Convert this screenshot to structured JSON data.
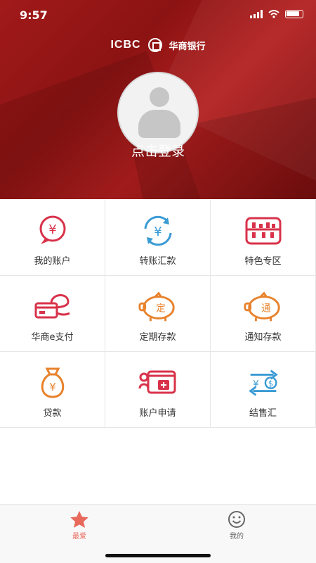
{
  "status": {
    "time": "9:57"
  },
  "brand": {
    "name_en": "ICBC",
    "name_cn": "华商银行"
  },
  "login": {
    "label": "点击登录"
  },
  "grid": [
    {
      "label": "我的账户",
      "icon": "yen-bubble-icon",
      "color": "#d8324a"
    },
    {
      "label": "转账汇款",
      "icon": "transfer-yen-icon",
      "color": "#3a9bd5"
    },
    {
      "label": "特色专区",
      "icon": "abacus-icon",
      "color": "#d8324a"
    },
    {
      "label": "华商e支付",
      "icon": "epay-card-icon",
      "color": "#d8324a"
    },
    {
      "label": "定期存款",
      "icon": "piggy-fixed-icon",
      "color": "#e8822c"
    },
    {
      "label": "通知存款",
      "icon": "piggy-notice-icon",
      "color": "#e8822c"
    },
    {
      "label": "贷款",
      "icon": "money-bag-icon",
      "color": "#e8822c"
    },
    {
      "label": "账户申请",
      "icon": "card-add-icon",
      "color": "#d8324a"
    },
    {
      "label": "结售汇",
      "icon": "currency-exchange-icon",
      "color": "#3a9bd5"
    }
  ],
  "tabs": [
    {
      "label": "最爱",
      "icon": "star-icon",
      "active": true
    },
    {
      "label": "我的",
      "icon": "smiley-icon",
      "active": false
    }
  ],
  "colors": {
    "accent": "#d8324a",
    "tab_active": "#e8685c",
    "tab_inactive": "#666666"
  }
}
